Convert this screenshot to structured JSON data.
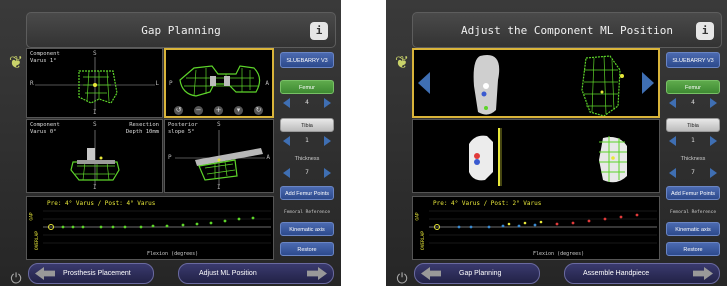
{
  "left": {
    "title": "Gap Planning",
    "info_label": "i",
    "views": {
      "top_left": {
        "text": "Component\nVarus 1°",
        "s": "S",
        "r": "R",
        "l": "L",
        "i": "I"
      },
      "top_right": {
        "p": "P",
        "a": "A"
      },
      "bottom_left": {
        "text": "Component\nVarus 0°",
        "s": "S",
        "i": "I",
        "resection": "Resection\nDepth 10mm"
      },
      "bottom_right": {
        "text": "Posterior\nslope 5°",
        "s": "S",
        "p": "P",
        "a": "A",
        "i": "I"
      }
    },
    "right_panel": {
      "implant_btn": "SLUEBARRY V3",
      "femur_btn": "Femur",
      "femur_value": "4",
      "tibia_btn": "Tibia",
      "tibia_value": "1",
      "thickness_label": "Thickness",
      "thickness_value": "7",
      "add_btn": "Add Femur Points",
      "femoral_ref_label": "Femoral Reference",
      "kinematic_btn": "Kinematic axis",
      "restore_btn": "Restore"
    },
    "gap_plot": {
      "title": "Pre: 4° Varus / Post: 4° Varus",
      "ylabel_top": "GAP",
      "ylabel_bottom": "OVERLAP",
      "xlabel": "Flexion (degrees)"
    },
    "nav_back": "Prosthesis Placement",
    "nav_forward": "Adjust ML Position"
  },
  "right": {
    "title": "Adjust the Component ML Position",
    "info_label": "i",
    "right_panel": {
      "implant_btn": "SLUEBARRY V3",
      "femur_btn": "Femur",
      "femur_value": "4",
      "tibia_btn": "Tibia",
      "tibia_value": "1",
      "thickness_label": "Thickness",
      "thickness_value": "7",
      "add_btn": "Add Femur Points",
      "femoral_ref_label": "Femoral Reference",
      "kinematic_btn": "Kinematic axis",
      "restore_btn": "Restore"
    },
    "gap_plot": {
      "title": "Pre: 4° Varus / Post: 2° Varus",
      "ylabel_top": "GAP",
      "ylabel_bottom": "OVERLAP",
      "xlabel": "Flexion (degrees)"
    },
    "nav_back": "Gap Planning",
    "nav_forward": "Assemble Handpiece"
  },
  "colors": {
    "accent_blue": "#3f6fb3",
    "selected_border": "#d9b43a",
    "model_green": "#5dd42a",
    "point_yellow": "#e8e83a",
    "point_red": "#e03a3a"
  },
  "icons": {
    "app": "fruit-logo-icon",
    "power": "power-icon"
  }
}
